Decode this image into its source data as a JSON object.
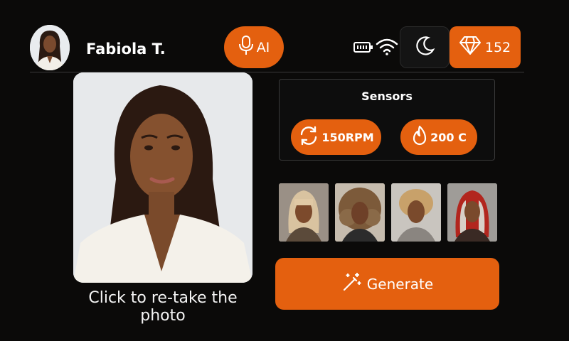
{
  "header": {
    "user_name": "Fabiola T.",
    "ai_label": "AI",
    "gems": "152"
  },
  "photo": {
    "caption": "Click to re-take the photo"
  },
  "sensors": {
    "title": "Sensors",
    "rpm": "150RPM",
    "temperature": "200 C"
  },
  "styles": [
    {
      "icon": "blonde-bangs-hairstyle"
    },
    {
      "icon": "curly-hairstyle"
    },
    {
      "icon": "short-curly-hairstyle"
    },
    {
      "icon": "red-highlights-hairstyle"
    }
  ],
  "actions": {
    "generate_label": "Generate"
  },
  "colors": {
    "accent": "#e4600f",
    "background": "#0b0a09"
  }
}
